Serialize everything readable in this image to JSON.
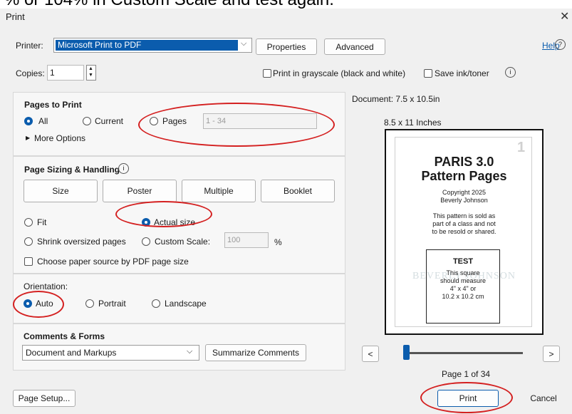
{
  "overlay_caption": "% or 104% in Custom Scale and test again.",
  "window": {
    "title": "Print"
  },
  "printer": {
    "label": "Printer:",
    "selected": "Microsoft Print to PDF",
    "properties_label": "Properties",
    "advanced_label": "Advanced",
    "help_label": "Help"
  },
  "copies": {
    "label": "Copies:",
    "value": "1"
  },
  "options": {
    "grayscale_label": "Print in grayscale (black and white)",
    "save_ink_label": "Save ink/toner"
  },
  "pages_to_print": {
    "heading": "Pages to Print",
    "all_label": "All",
    "current_label": "Current",
    "pages_label": "Pages",
    "pages_value": "1 - 34",
    "more_options_label": "More Options"
  },
  "sizing": {
    "heading": "Page Sizing & Handling",
    "tabs": [
      "Size",
      "Poster",
      "Multiple",
      "Booklet"
    ],
    "fit_label": "Fit",
    "actual_size_label": "Actual size",
    "shrink_label": "Shrink oversized pages",
    "custom_scale_label": "Custom Scale:",
    "custom_scale_value": "100",
    "percent_label": "%",
    "paper_source_label": "Choose paper source by PDF page size"
  },
  "orientation": {
    "heading": "Orientation:",
    "auto_label": "Auto",
    "portrait_label": "Portrait",
    "landscape_label": "Landscape"
  },
  "comments": {
    "heading": "Comments & Forms",
    "selected": "Document and Markups",
    "summarize_label": "Summarize Comments"
  },
  "preview": {
    "document_size": "Document: 7.5 x 10.5in",
    "paper_size": "8.5 x 11 Inches",
    "page_number_mark": "1",
    "page_title_1": "PARIS 3.0",
    "page_title_2": "Pattern Pages",
    "copyright_1": "Copyright 2025",
    "copyright_2": "Beverly Johnson",
    "notice_1": "This pattern is sold as",
    "notice_2": "part of a class and not",
    "notice_3": "to be resold or shared.",
    "test_heading": "TEST",
    "test_1": "This square",
    "test_2": "should measure",
    "test_3": "4\" x 4\" or",
    "test_4": "10.2 x 10.2 cm",
    "watermark": "BEVERLY JOHNSON",
    "prev_label": "<",
    "next_label": ">",
    "page_indicator": "Page 1 of 34",
    "slider_position": 0.0
  },
  "footer": {
    "page_setup_label": "Page Setup...",
    "print_label": "Print",
    "cancel_label": "Cancel"
  },
  "colors": {
    "accent": "#0b5cad",
    "highlight_annotation": "#d42020"
  }
}
